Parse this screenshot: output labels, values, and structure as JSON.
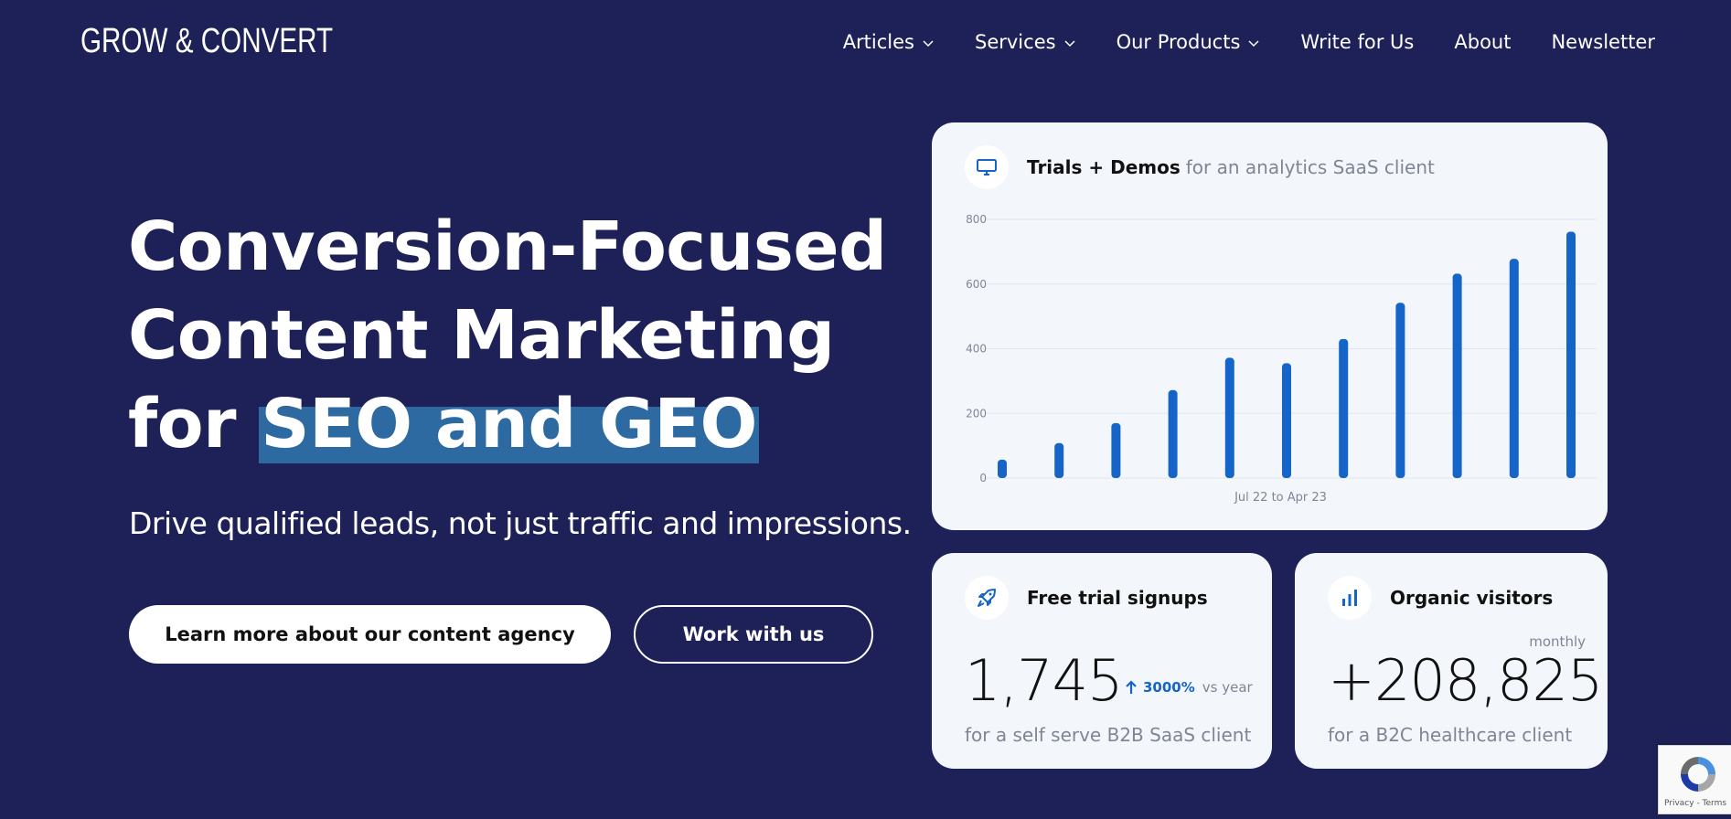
{
  "header": {
    "logo": "GROW & CONVERT",
    "nav": [
      {
        "label": "Articles",
        "dropdown": true
      },
      {
        "label": "Services",
        "dropdown": true
      },
      {
        "label": "Our Products",
        "dropdown": true
      },
      {
        "label": "Write for Us",
        "dropdown": false
      },
      {
        "label": "About",
        "dropdown": false
      },
      {
        "label": "Newsletter",
        "dropdown": false
      }
    ]
  },
  "hero": {
    "title_line1": "Conversion-Focused",
    "title_line2": "Content Marketing",
    "title_line3_prefix": "for ",
    "title_line3_highlight": "SEO and GEO",
    "subtitle": "Drive qualified leads, not just traffic and impressions.",
    "primary_button": "Learn more about our content agency",
    "secondary_button": "Work with us"
  },
  "chart_card": {
    "icon": "monitor-icon",
    "title": "Trials + Demos",
    "subtitle": "for an analytics SaaS client",
    "chart_data": {
      "type": "bar",
      "xlabel": "Jul 22 to Apr 23",
      "ylim": [
        0,
        800
      ],
      "yticks": [
        "0",
        "200",
        "400",
        "600",
        "800"
      ],
      "values": [
        57,
        108,
        170,
        272,
        372,
        355,
        430,
        542,
        632,
        678,
        762
      ],
      "grid": true,
      "bar_color": "#1565c9"
    }
  },
  "card_signups": {
    "icon": "rocket-icon",
    "title": "Free trial signups",
    "value": "1,745",
    "growth_pct": "3000%",
    "growth_vs": "vs year",
    "footer": "for a self serve B2B SaaS client"
  },
  "card_visitors": {
    "icon": "bar-chart-icon",
    "title": "Organic visitors",
    "period": "monthly",
    "value": "+208,825",
    "footer": "for a B2C healthcare client"
  },
  "recaptcha": {
    "text": "Privacy - Terms"
  },
  "colors": {
    "background": "#1e2157",
    "accent": "#1565c9",
    "highlight": "#2d6aa1",
    "card": "#f3f6fb"
  }
}
